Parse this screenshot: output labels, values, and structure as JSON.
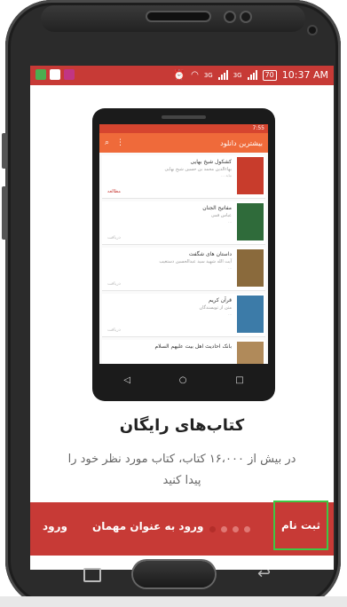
{
  "statusbar": {
    "time": "10:37 AM",
    "battery": "70",
    "network1": "3G",
    "network2": "3G",
    "icons": [
      "whatsapp-icon",
      "gmail-icon",
      "instagram-icon",
      "alarm-icon",
      "wifi-icon",
      "signal-icon",
      "battery-icon"
    ]
  },
  "mockup": {
    "toolbar_title": "بیشترین دانلود",
    "status_time": "7:55",
    "items": [
      {
        "title": "کشکول شیخ بهایی",
        "subtitle": "بهاءالدین محمد بن حسین شیخ بهایی",
        "meta": "بیاید ...",
        "action": "مطالعه",
        "thumb_color": "#c83c2c"
      },
      {
        "title": "مفاتیح الجنان",
        "subtitle": "عباس قمی",
        "meta": "...",
        "action": "دریافت",
        "thumb_color": "#2f6b3a"
      },
      {
        "title": "داستان های شگفت",
        "subtitle": "آیت الله شهید سید عبدالحسین دستغیب",
        "meta": "...",
        "action": "دریافت",
        "thumb_color": "#8a6a3c"
      },
      {
        "title": "قرآن کریم",
        "subtitle": "متن از تویسندگان",
        "meta": "...",
        "action": "دریافت",
        "thumb_color": "#3c7ba8"
      },
      {
        "title": "بانک احادیث اهل بیت علیهم السلام",
        "subtitle": "",
        "meta": "",
        "action": "",
        "thumb_color": "#b08a5a"
      }
    ]
  },
  "onboarding": {
    "heading": "کتاب‌های رایگان",
    "description": "در بیش از ۱۶،۰۰۰ کتاب، کتاب مورد نظر خود را پیدا کنید"
  },
  "bottombar": {
    "login": "ورود",
    "guest_login": "ورود به عنوان مهمان",
    "signup": "ثبت نام",
    "page_count": 4,
    "active_page": 1
  },
  "colors": {
    "accent": "#c73a36",
    "highlight": "#3ec844"
  }
}
